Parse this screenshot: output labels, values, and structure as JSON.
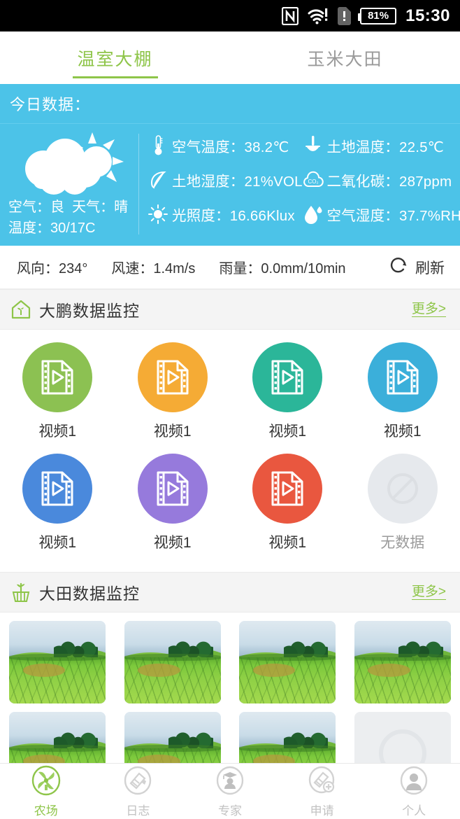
{
  "statusbar": {
    "icons": [
      "nfc-icon",
      "wifi-alert-icon",
      "sim-alert-icon"
    ],
    "battery_text": "81%",
    "time": "15:30"
  },
  "tabs": [
    {
      "label": "温室大棚",
      "active": true
    },
    {
      "label": "玉米大田",
      "active": false
    }
  ],
  "today_panel": {
    "title": "今日数据：",
    "weather": {
      "icon": "partly-cloudy-icon",
      "air_quality": "空气：良",
      "condition": "天气：晴",
      "temperature_range": "温度：30/17C"
    },
    "metrics": [
      {
        "icon": "thermometer-icon",
        "text": "空气温度：38.2℃"
      },
      {
        "icon": "soil-thermometer-icon",
        "text": "土地温度：22.5℃"
      },
      {
        "icon": "sprout-icon",
        "text": "土地湿度：21%VOL"
      },
      {
        "icon": "co2-cloud-icon",
        "text": "二氧化碳：287ppm"
      },
      {
        "icon": "sun-icon",
        "text": "光照度：16.66Klux"
      },
      {
        "icon": "water-drop-icon",
        "text": "空气湿度：37.7%RH"
      }
    ]
  },
  "wind_row": {
    "wind_direction": "风向：234°",
    "wind_speed": "风速：1.4m/s",
    "rainfall": "雨量：0.0mm/10min",
    "refresh_label": "刷新",
    "refresh_icon": "refresh-icon"
  },
  "greenhouse_section": {
    "icon": "greenhouse-icon",
    "title": "大鹏数据监控",
    "more_label": "更多>",
    "items": [
      {
        "label": "视频1",
        "color": "#8CC152",
        "icon": "video-file-icon",
        "empty": false
      },
      {
        "label": "视频1",
        "color": "#F5AB35",
        "icon": "video-file-icon",
        "empty": false
      },
      {
        "label": "视频1",
        "color": "#2BB699",
        "icon": "video-file-icon",
        "empty": false
      },
      {
        "label": "视频1",
        "color": "#3BAFDA",
        "icon": "video-file-icon",
        "empty": false
      },
      {
        "label": "视频1",
        "color": "#4A89DC",
        "icon": "video-file-icon",
        "empty": false
      },
      {
        "label": "视频1",
        "color": "#967ADC",
        "icon": "video-file-icon",
        "empty": false
      },
      {
        "label": "视频1",
        "color": "#E9573F",
        "icon": "video-file-icon",
        "empty": false
      },
      {
        "label": "无数据",
        "color": "#E6E9ED",
        "icon": "no-data-icon",
        "empty": true
      }
    ]
  },
  "field_section": {
    "icon": "field-crop-icon",
    "title": "大田数据监控",
    "more_label": "更多>",
    "items": [
      {
        "empty": false
      },
      {
        "empty": false
      },
      {
        "empty": false
      },
      {
        "empty": false
      },
      {
        "empty": false
      },
      {
        "empty": false
      },
      {
        "empty": false
      },
      {
        "empty": true
      }
    ]
  },
  "bottom_nav": [
    {
      "label": "农场",
      "icon": "windmill-icon",
      "active": true
    },
    {
      "label": "日志",
      "icon": "notebook-pen-icon",
      "active": false
    },
    {
      "label": "专家",
      "icon": "graduate-icon",
      "active": false
    },
    {
      "label": "申请",
      "icon": "notebook-plus-icon",
      "active": false
    },
    {
      "label": "个人",
      "icon": "person-icon",
      "active": false
    }
  ],
  "colors": {
    "accent_green": "#8EC549",
    "panel_blue": "#4CC3E8",
    "statusbar_black": "#000000",
    "section_bg": "#F4F4F4",
    "muted_gray": "#9A9A9A"
  }
}
